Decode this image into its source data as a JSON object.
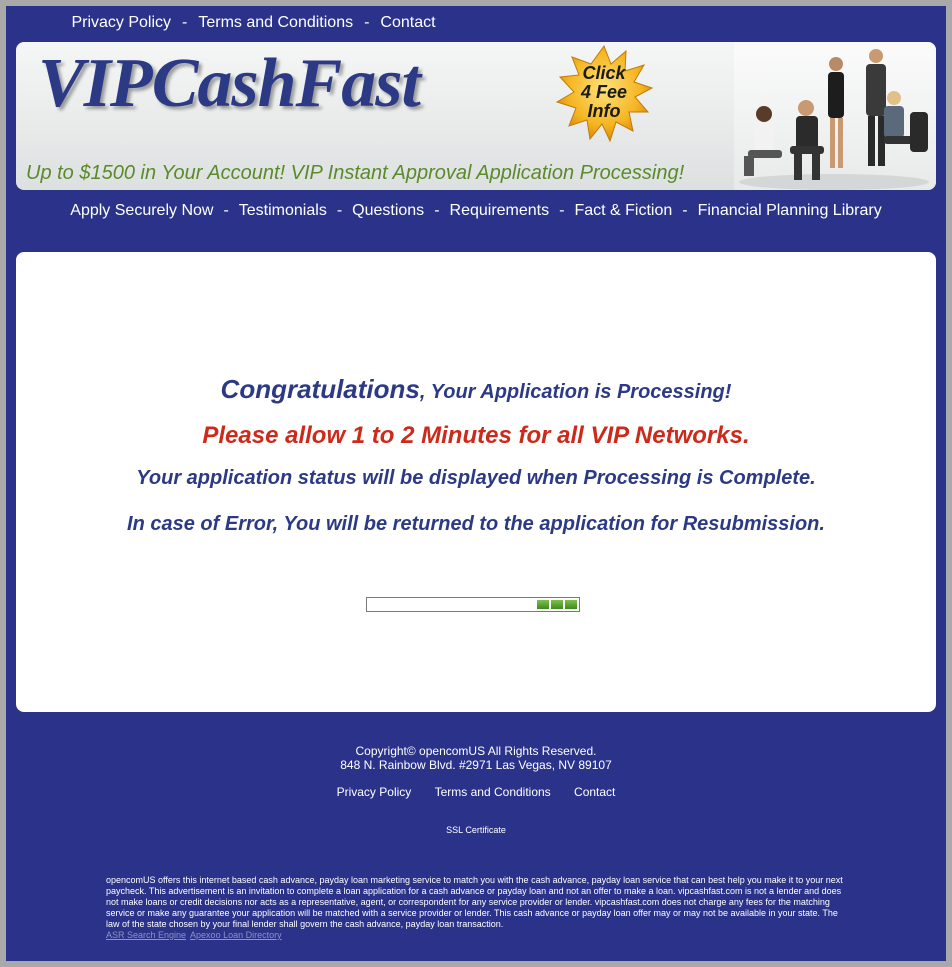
{
  "top_links": [
    "Privacy Policy",
    "Terms and Conditions",
    "Contact"
  ],
  "top_sep": "-",
  "banner": {
    "logo": "VIPCashFast",
    "starburst": [
      "Click",
      "4 Fee",
      "Info"
    ],
    "tagline": "Up to $1500 in Your Account! VIP Instant Approval Application Processing!"
  },
  "nav": [
    "Apply Securely Now",
    "Testimonials",
    "Questions",
    "Requirements",
    "Fact & Fiction",
    "Financial Planning Library"
  ],
  "nav_sep": "-",
  "main": {
    "line1_big": "Congratulations",
    "line1_rest": ", Your Application is Processing!",
    "line2": "Please allow 1 to 2 Minutes for all VIP Networks.",
    "line3": "Your application status will be displayed when Processing is Complete.",
    "line4": "In case of Error, You will be returned to the application for Resubmission.",
    "progress_segments": 3
  },
  "footer": {
    "copyright": "Copyright© opencomUS All Rights Reserved.",
    "address": "848 N. Rainbow Blvd. #2971 Las Vegas, NV 89107",
    "links": [
      "Privacy Policy",
      "Terms and Conditions",
      "Contact"
    ],
    "ssl": "SSL Certificate",
    "disclaimer": "opencomUS offers this internet based cash advance, payday loan marketing service to match you with the cash advance, payday loan service that can best help you make it to your next paycheck. This advertisement is an invitation to complete a loan application for a cash advance or payday loan and not an offer to make a loan. vipcashfast.com is not a lender and does not make loans or credit decisions nor acts as a representative, agent, or correspondent for any service provider or lender. vipcashfast.com does not charge any fees for the matching service or make any guarantee your application will be matched with a service provider or lender. This cash advance or payday loan offer may or may not be available in your state. The law of the state chosen by your final lender shall govern the cash advance, payday loan transaction.",
    "directory_links": [
      "ASR Search Engine",
      "Apexoo Loan Directory"
    ]
  },
  "colors": {
    "page_bg": "#2a3389",
    "logo": "#2c3a86",
    "tagline": "#5a8a2a",
    "alert_red": "#cc2a1a",
    "progress_green": "#5aa832"
  }
}
